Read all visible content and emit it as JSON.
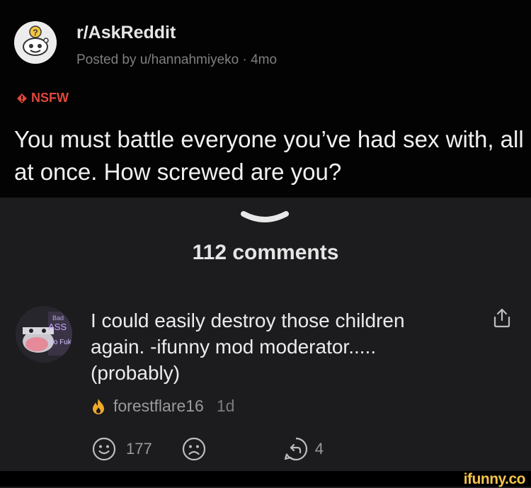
{
  "post": {
    "subreddit": "r/AskReddit",
    "meta": "Posted by u/hannahmiyeko · 4mo",
    "tag": "NSFW",
    "title": "You must battle everyone you’ve had sex with, all at once. How screwed are you?"
  },
  "comments_count": "112 comments",
  "comment": {
    "text": "I could easily destroy those children again. -ifunny mod moderator.....(probably)",
    "avatar_text": "Bad ASS Go Fuk",
    "username": "forestflare16",
    "age": "1d",
    "upvotes": "177",
    "replies": "4"
  },
  "icons": {
    "share": "share-icon",
    "upvote": "smile-face-icon",
    "downvote": "frown-face-icon",
    "reply": "reply-icon",
    "fire": "fire-icon",
    "collapse": "chevron-down-icon"
  },
  "colors": {
    "nsfw": "#e0473c",
    "watermark": "#f6c54a",
    "fire": "#f0a92a"
  },
  "watermark": "ifunny.co"
}
